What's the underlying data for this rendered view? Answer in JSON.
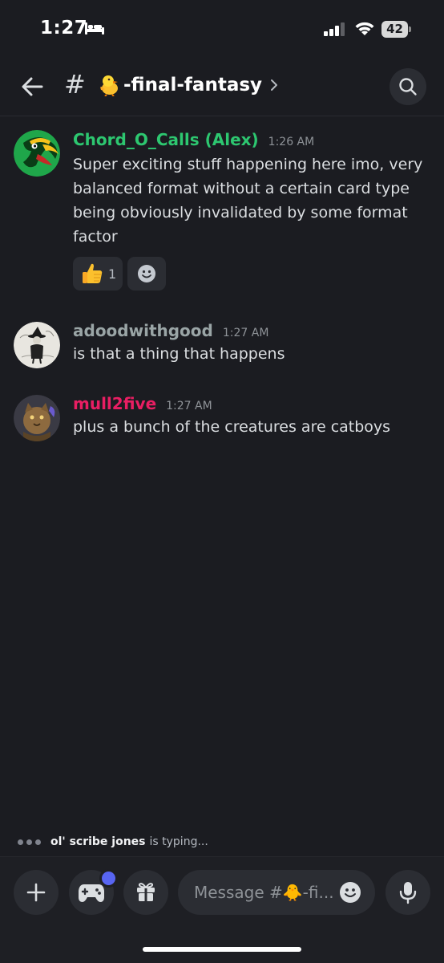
{
  "status_bar": {
    "time": "1:27",
    "battery_level": "42"
  },
  "header": {
    "channel_prefix": "#",
    "channel_name": "-final-fantasy",
    "channel_emoji_icon": "baby-chick-icon"
  },
  "messages": [
    {
      "username": "Chord_O_Calls (Alex)",
      "username_color": "#2dc770",
      "timestamp": "1:26 AM",
      "text": "Super exciting stuff happening here imo, very balanced format without a certain card type being obviously invalidated by some format factor",
      "reactions": [
        {
          "emoji_icon": "thumbs-up-icon",
          "count": "1"
        }
      ]
    },
    {
      "username": "adoodwithgood",
      "username_color": "#9aa5a6",
      "timestamp": "1:27 AM",
      "text": "is that a thing that happens"
    },
    {
      "username": "mull2five",
      "username_color": "#e91e63",
      "timestamp": "1:27 AM",
      "text": "plus a bunch of the creatures are catboys"
    }
  ],
  "typing": {
    "user": "ol' scribe jones",
    "text": "is typing..."
  },
  "composer": {
    "placeholder": "Message #🐥-fi..."
  },
  "colors": {
    "background": "#1b1c21",
    "accent": "#5865f2"
  }
}
